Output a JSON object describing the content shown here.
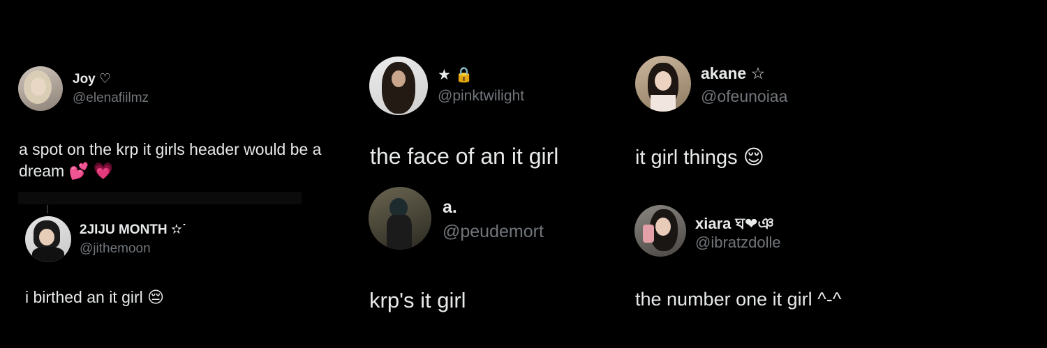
{
  "tweets": [
    {
      "name": "Joy ♡",
      "handle": "@elenafiilmz",
      "text": "a spot on the krp it girls header would be a\ndream 💕 💗"
    },
    {
      "name": "2JIJU MONTH ✫˙",
      "handle": "@jithemoon",
      "text": "i birthed an it girl 😔"
    },
    {
      "name": "★ 🔒",
      "handle": "@pinktwilight",
      "text": "the face of an it girl"
    },
    {
      "name": "a.",
      "handle": "@peudemort",
      "text": "krp's it girl"
    },
    {
      "name": "akane ☆",
      "handle": "@ofeunoiaa",
      "text": "it girl things 😌"
    },
    {
      "name": "xiara ঘ❤︎ঞ",
      "handle": "@ibratzdolle",
      "text": "the number one it girl ^-^"
    }
  ]
}
